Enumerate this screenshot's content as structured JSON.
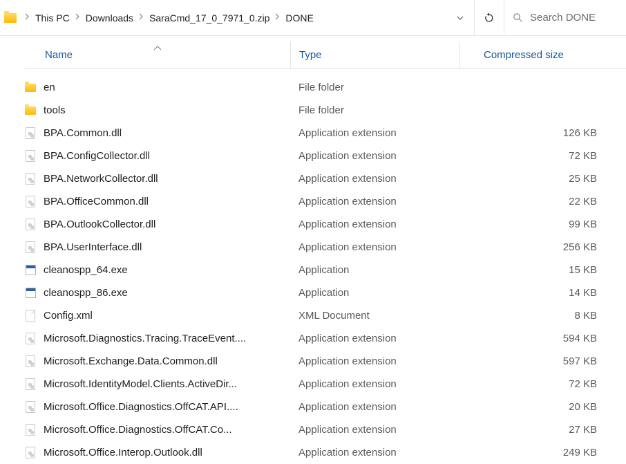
{
  "breadcrumb": {
    "items": [
      "This PC",
      "Downloads",
      "SaraCmd_17_0_7971_0.zip",
      "DONE"
    ]
  },
  "search": {
    "placeholder": "Search DONE"
  },
  "columns": {
    "name": "Name",
    "type": "Type",
    "size": "Compressed size"
  },
  "files": [
    {
      "icon": "folder",
      "name": "en",
      "type": "File folder",
      "size": ""
    },
    {
      "icon": "folder",
      "name": "tools",
      "type": "File folder",
      "size": ""
    },
    {
      "icon": "dll",
      "name": "BPA.Common.dll",
      "type": "Application extension",
      "size": "126 KB"
    },
    {
      "icon": "dll",
      "name": "BPA.ConfigCollector.dll",
      "type": "Application extension",
      "size": "72 KB"
    },
    {
      "icon": "dll",
      "name": "BPA.NetworkCollector.dll",
      "type": "Application extension",
      "size": "25 KB"
    },
    {
      "icon": "dll",
      "name": "BPA.OfficeCommon.dll",
      "type": "Application extension",
      "size": "22 KB"
    },
    {
      "icon": "dll",
      "name": "BPA.OutlookCollector.dll",
      "type": "Application extension",
      "size": "99 KB"
    },
    {
      "icon": "dll",
      "name": "BPA.UserInterface.dll",
      "type": "Application extension",
      "size": "256 KB"
    },
    {
      "icon": "exe",
      "name": "cleanospp_64.exe",
      "type": "Application",
      "size": "15 KB"
    },
    {
      "icon": "exe",
      "name": "cleanospp_86.exe",
      "type": "Application",
      "size": "14 KB"
    },
    {
      "icon": "xml",
      "name": "Config.xml",
      "type": "XML Document",
      "size": "8 KB"
    },
    {
      "icon": "dll",
      "name": "Microsoft.Diagnostics.Tracing.TraceEvent....",
      "type": "Application extension",
      "size": "594 KB"
    },
    {
      "icon": "dll",
      "name": "Microsoft.Exchange.Data.Common.dll",
      "type": "Application extension",
      "size": "597 KB"
    },
    {
      "icon": "dll",
      "name": "Microsoft.IdentityModel.Clients.ActiveDir...",
      "type": "Application extension",
      "size": "72 KB"
    },
    {
      "icon": "dll",
      "name": "Microsoft.Office.Diagnostics.OffCAT.API....",
      "type": "Application extension",
      "size": "20 KB"
    },
    {
      "icon": "dll",
      "name": "Microsoft.Office.Diagnostics.OffCAT.Co...",
      "type": "Application extension",
      "size": "27 KB"
    },
    {
      "icon": "dll",
      "name": "Microsoft.Office.Interop.Outlook.dll",
      "type": "Application extension",
      "size": "249 KB"
    }
  ]
}
